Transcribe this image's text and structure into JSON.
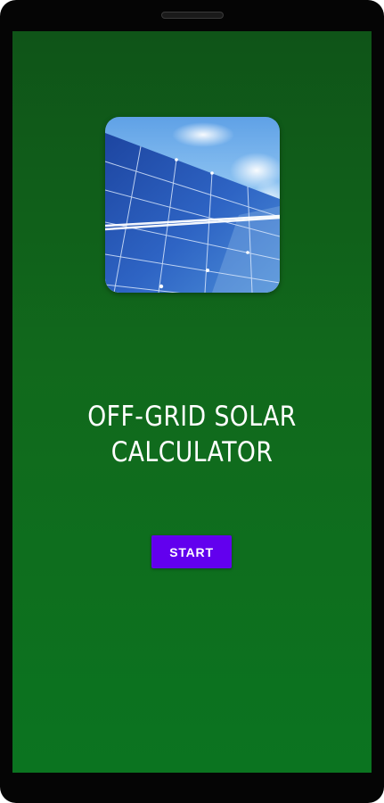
{
  "screen": {
    "title_line_1": "OFF-GRID SOLAR",
    "title_line_2": "CALCULATOR",
    "start_label": "START",
    "image_alt": "solar panel",
    "icon": "solar-panel-image"
  },
  "colors": {
    "background_top": "#0f5418",
    "background_bottom": "#0b7420",
    "accent_button": "#6200ee",
    "text": "#ffffff"
  }
}
